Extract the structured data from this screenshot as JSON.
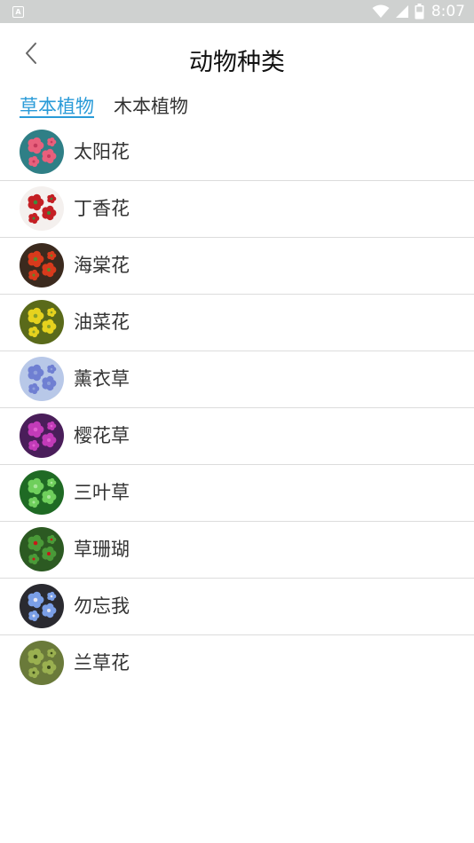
{
  "status_bar": {
    "time": "8:07",
    "left_icon": "A",
    "icons": [
      "wifi-icon",
      "signal-icon",
      "battery-icon"
    ]
  },
  "header": {
    "title": "动物种类",
    "back_icon": "chevron-left-icon"
  },
  "tabs": [
    {
      "label": "草本植物",
      "active": true
    },
    {
      "label": "木本植物",
      "active": false
    }
  ],
  "colors": {
    "accent": "#2a9bd8",
    "status_bar": "#cfd1d0",
    "text": "#333333",
    "divider": "#dcdcdc"
  },
  "plants": [
    {
      "name": "太阳花",
      "thumb": {
        "bg": "#2f7f86",
        "petal": "#e8607c",
        "center": "#c33a5c"
      }
    },
    {
      "name": "丁香花",
      "thumb": {
        "bg": "#f4f0ee",
        "petal": "#c41f24",
        "center": "#3f8a3c"
      }
    },
    {
      "name": "海棠花",
      "thumb": {
        "bg": "#3b2a1e",
        "petal": "#d83a1c",
        "center": "#5c8a2a"
      }
    },
    {
      "name": "油菜花",
      "thumb": {
        "bg": "#5a6a1a",
        "petal": "#e6d21e",
        "center": "#8aa028"
      }
    },
    {
      "name": "薰衣草",
      "thumb": {
        "bg": "#b8c8e8",
        "petal": "#6f7fd2",
        "center": "#8fa0dc"
      }
    },
    {
      "name": "樱花草",
      "thumb": {
        "bg": "#4a1e5a",
        "petal": "#c23bb8",
        "center": "#e060d0"
      }
    },
    {
      "name": "三叶草",
      "thumb": {
        "bg": "#1f6a24",
        "petal": "#6fcf5c",
        "center": "#a8e69a"
      }
    },
    {
      "name": "草珊瑚",
      "thumb": {
        "bg": "#2c5a22",
        "petal": "#4a9a38",
        "center": "#c81818"
      }
    },
    {
      "name": "勿忘我",
      "thumb": {
        "bg": "#2a2a30",
        "petal": "#7a9ee6",
        "center": "#e6e6f0"
      }
    },
    {
      "name": "兰草花",
      "thumb": {
        "bg": "#6a7a3a",
        "petal": "#9ab050",
        "center": "#3a4a1a"
      }
    }
  ]
}
